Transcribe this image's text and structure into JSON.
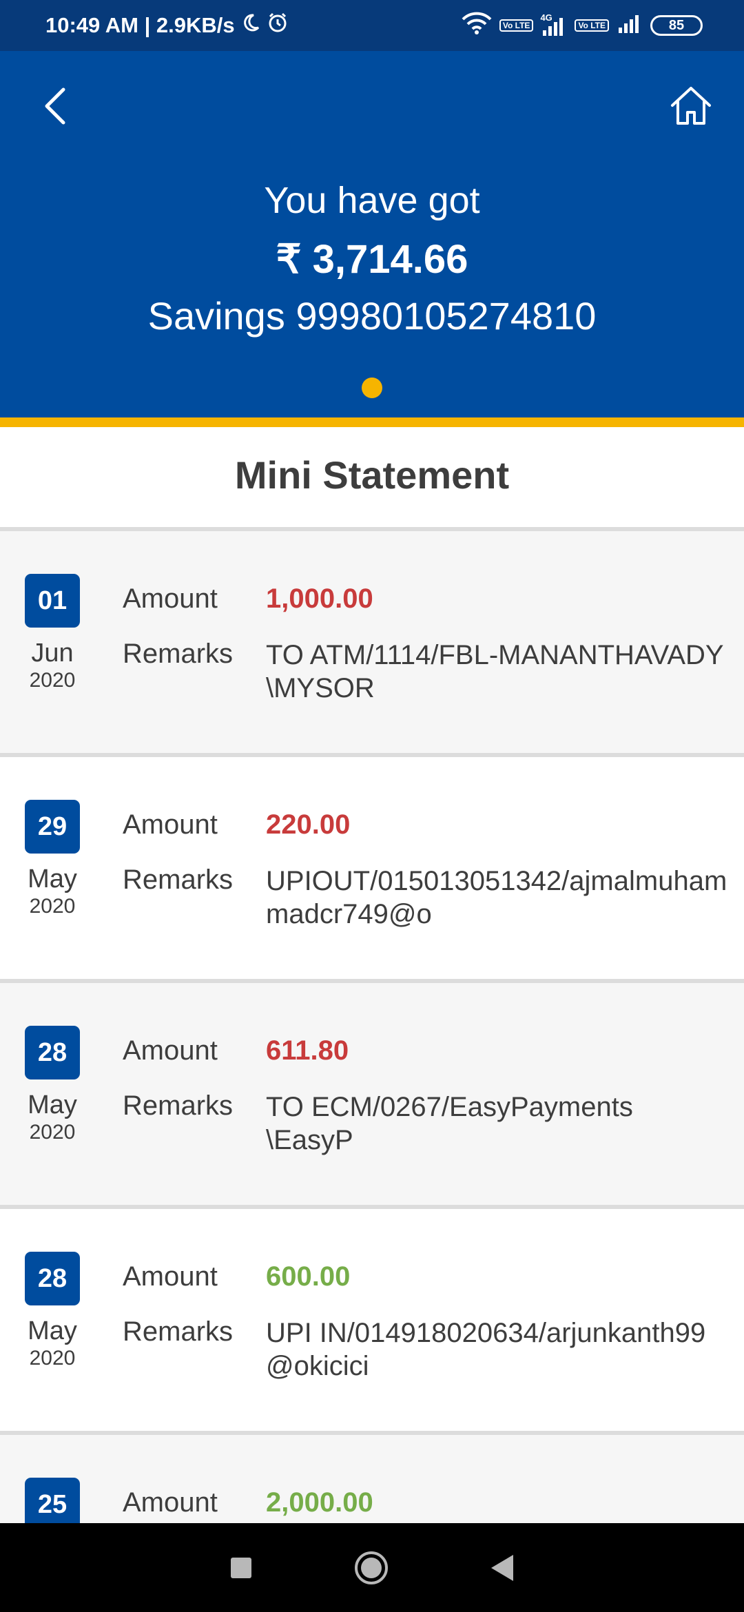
{
  "status_bar": {
    "time_speed": "10:49 AM | 2.9KB/s",
    "network_type": "4G",
    "volte": "Vo LTE",
    "battery": "85"
  },
  "header": {
    "headline": "You have got",
    "balance": "₹ 3,714.66",
    "account": "Savings 99980105274810"
  },
  "section_title": "Mini Statement",
  "transactions": [
    {
      "day": "01",
      "month": "Jun",
      "year": "2020",
      "amount_label": "Amount",
      "amount": "1,000.00",
      "type": "debit",
      "remarks_label": "Remarks",
      "remarks": "TO ATM/1114/FBL-MANANTHAVADY      \\MYSOR"
    },
    {
      "day": "29",
      "month": "May",
      "year": "2020",
      "amount_label": "Amount",
      "amount": "220.00",
      "type": "debit",
      "remarks_label": "Remarks",
      "remarks": "UPIOUT/015013051342/ajmalmuhammadcr749@o"
    },
    {
      "day": "28",
      "month": "May",
      "year": "2020",
      "amount_label": "Amount",
      "amount": "611.80",
      "type": "debit",
      "remarks_label": "Remarks",
      "remarks": "TO ECM/0267/EasyPayments          \\EasyP"
    },
    {
      "day": "28",
      "month": "May",
      "year": "2020",
      "amount_label": "Amount",
      "amount": "600.00",
      "type": "credit",
      "remarks_label": "Remarks",
      "remarks": "UPI IN/014918020634/arjunkanth99@okicici"
    },
    {
      "day": "25",
      "month": "",
      "year": "",
      "amount_label": "Amount",
      "amount": "2,000.00",
      "type": "credit",
      "remarks_label": "",
      "remarks": ""
    }
  ],
  "colors": {
    "header_bg": "#004c9e",
    "status_bg": "#073a7a",
    "accent": "#f6b400",
    "debit": "#c83b3b",
    "credit": "#76ad49"
  },
  "icons": {
    "back": "chevron-left-icon",
    "home": "home-icon"
  }
}
